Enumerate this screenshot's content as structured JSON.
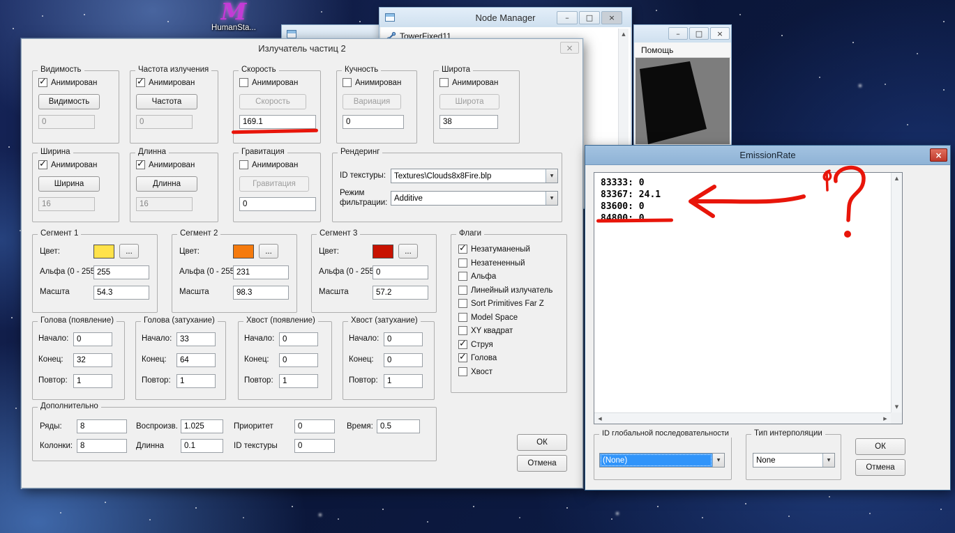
{
  "annotations": {
    "color": "#e8150a"
  },
  "icons": {
    "minimize": "–",
    "maximize": "□",
    "close": "×",
    "combo_arrow": "▼",
    "scroll_up": "▲",
    "scroll_down": "▼",
    "scroll_left": "◀",
    "scroll_right": "▶"
  },
  "desktop": {
    "icon_label": "HumanSta...",
    "logo_glyph": "M"
  },
  "node_manager": {
    "title": "Node Manager",
    "item_label": "TowerFixed11"
  },
  "help_window": {
    "menu_label": "Помощь"
  },
  "emitter": {
    "title": "Излучатель частиц 2",
    "anim_label": "Анимирован",
    "visibility": {
      "title": "Видимость",
      "button": "Видимость",
      "value": "0",
      "animated": true
    },
    "emission": {
      "title": "Частота излучения",
      "button": "Частота",
      "value": "0",
      "animated": true
    },
    "speed": {
      "title": "Скорость",
      "button": "Скорость",
      "value": "169.1",
      "animated": false
    },
    "variation": {
      "title": "Кучность",
      "button": "Вариация",
      "value": "0",
      "animated": false
    },
    "latitude": {
      "title": "Широта",
      "button": "Широта",
      "value": "38",
      "animated": false
    },
    "width": {
      "title": "Ширина",
      "button": "Ширина",
      "value": "16",
      "animated": true
    },
    "length": {
      "title": "Длинна",
      "button": "Длинна",
      "value": "16",
      "animated": true
    },
    "gravity": {
      "title": "Гравитация",
      "button": "Гравитация",
      "value": "0",
      "animated": false
    },
    "rendering": {
      "title": "Рендеринг",
      "texture_label": "ID текстуры:",
      "texture_value": "Textures\\Clouds8x8Fire.blp",
      "filter_label": "Режим фильтрации:",
      "filter_value": "Additive"
    },
    "segment_labels": {
      "color": "Цвет:",
      "alpha": "Альфа (0 - 255)",
      "scale": "Масшта",
      "more": "..."
    },
    "segment1": {
      "title": "Сегмент 1",
      "color": "#ffe24a",
      "alpha": "255",
      "scale": "54.3"
    },
    "segment2": {
      "title": "Сегмент 2",
      "color": "#f57a0d",
      "alpha": "231",
      "scale": "98.3"
    },
    "segment3": {
      "title": "Сегмент 3",
      "color": "#c81200",
      "alpha": "0",
      "scale": "57.2"
    },
    "flags": {
      "title": "Флаги",
      "items": [
        {
          "label": "Незатуманеный",
          "checked": true
        },
        {
          "label": "Незатененный",
          "checked": false
        },
        {
          "label": "Альфа",
          "checked": false
        },
        {
          "label": "Линейный излучатель",
          "checked": false
        },
        {
          "label": "Sort Primitives Far Z",
          "checked": false
        },
        {
          "label": "Model Space",
          "checked": false
        },
        {
          "label": "XY квадрат",
          "checked": false
        },
        {
          "label": "Струя",
          "checked": true
        },
        {
          "label": "Голова",
          "checked": true
        },
        {
          "label": "Хвост",
          "checked": false
        }
      ]
    },
    "life_labels": {
      "start": "Начало:",
      "end": "Конец:",
      "repeat": "Повтор:"
    },
    "head_life": {
      "title": "Голова (появление)",
      "start": "0",
      "end": "32",
      "repeat": "1"
    },
    "head_decay": {
      "title": "Голова (затухание)",
      "start": "33",
      "end": "64",
      "repeat": "1"
    },
    "tail_life": {
      "title": "Хвост (появление)",
      "start": "0",
      "end": "0",
      "repeat": "1"
    },
    "tail_decay": {
      "title": "Хвост (затухание)",
      "start": "0",
      "end": "0",
      "repeat": "1"
    },
    "additional": {
      "title": "Дополнительно",
      "rows_label": "Ряды:",
      "rows_value": "8",
      "cols_label": "Колонки:",
      "cols_value": "8",
      "replay_label": "Воспроизв.",
      "replay_value": "1.025",
      "length_label": "Длинна",
      "length_value": "0.1",
      "priority_label": "Приоритет",
      "priority_value": "0",
      "texid_label": "ID текстуры",
      "texid_value": "0",
      "time_label": "Время:",
      "time_value": "0.5"
    },
    "ok": "ОК",
    "cancel": "Отмена"
  },
  "emission_window": {
    "title": "EmissionRate",
    "lines": [
      "83333: 0",
      "83367: 24.1",
      "83600: 0",
      "84800: 0"
    ],
    "global_seq_title": "ID глобальной последовательности",
    "global_seq_value": "(None)",
    "interp_title": "Тип интерполяции",
    "interp_value": "None",
    "ok": "ОК",
    "cancel": "Отмена"
  }
}
